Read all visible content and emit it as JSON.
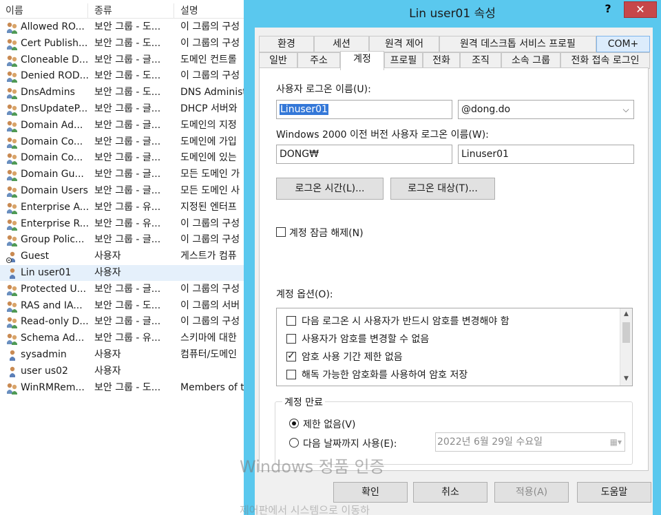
{
  "list": {
    "columns": [
      "이름",
      "종류",
      "설명"
    ],
    "rows": [
      {
        "name": "Allowed RO...",
        "type": "보안 그룹 - 도...",
        "desc": "이 그룹의 구성",
        "icon": "group-icon"
      },
      {
        "name": "Cert Publish...",
        "type": "보안 그룹 - 도...",
        "desc": "이 그룹의 구성",
        "icon": "group-icon"
      },
      {
        "name": "Cloneable D...",
        "type": "보안 그룹 - 글...",
        "desc": "도메인 컨트롤",
        "icon": "group-icon"
      },
      {
        "name": "Denied ROD...",
        "type": "보안 그룹 - 도...",
        "desc": "이 그룹의 구성",
        "icon": "group-icon"
      },
      {
        "name": "DnsAdmins",
        "type": "보안 그룹 - 도...",
        "desc": "DNS Administ",
        "icon": "group-icon"
      },
      {
        "name": "DnsUpdateP...",
        "type": "보안 그룹 - 글...",
        "desc": "DHCP 서버와",
        "icon": "group-icon"
      },
      {
        "name": "Domain Ad...",
        "type": "보안 그룹 - 글...",
        "desc": "도메인의 지정",
        "icon": "group-icon"
      },
      {
        "name": "Domain Co...",
        "type": "보안 그룹 - 글...",
        "desc": "도메인에 가입",
        "icon": "group-icon"
      },
      {
        "name": "Domain Co...",
        "type": "보안 그룹 - 글...",
        "desc": "도메인에 있는",
        "icon": "group-icon"
      },
      {
        "name": "Domain Gu...",
        "type": "보안 그룹 - 글...",
        "desc": "모든 도메인 가",
        "icon": "group-icon"
      },
      {
        "name": "Domain Users",
        "type": "보안 그룹 - 글...",
        "desc": "모든 도메인 사",
        "icon": "group-icon"
      },
      {
        "name": "Enterprise A...",
        "type": "보안 그룹 - 유...",
        "desc": "지정된 엔터프",
        "icon": "group-icon"
      },
      {
        "name": "Enterprise R...",
        "type": "보안 그룹 - 유...",
        "desc": "이 그룹의 구성",
        "icon": "group-icon"
      },
      {
        "name": "Group Polic...",
        "type": "보안 그룹 - 글...",
        "desc": "이 그룹의 구성",
        "icon": "group-icon"
      },
      {
        "name": "Guest",
        "type": "사용자",
        "desc": "게스트가 컴퓨",
        "icon": "disabled-user-icon"
      },
      {
        "name": "Lin user01",
        "type": "사용자",
        "desc": "",
        "icon": "user-icon"
      },
      {
        "name": "Protected U...",
        "type": "보안 그룹 - 글...",
        "desc": "이 그룹의 구성",
        "icon": "group-icon"
      },
      {
        "name": "RAS and IA...",
        "type": "보안 그룹 - 도...",
        "desc": "이 그룹의 서버",
        "icon": "group-icon"
      },
      {
        "name": "Read-only D...",
        "type": "보안 그룹 - 글...",
        "desc": "이 그룹의 구성",
        "icon": "group-icon"
      },
      {
        "name": "Schema Ad...",
        "type": "보안 그룹 - 유...",
        "desc": "스키마에 대한",
        "icon": "group-icon"
      },
      {
        "name": "sysadmin",
        "type": "사용자",
        "desc": "컴퓨터/도메인",
        "icon": "user-icon"
      },
      {
        "name": "user us02",
        "type": "사용자",
        "desc": "",
        "icon": "user-icon"
      },
      {
        "name": "WinRMRem...",
        "type": "보안 그룹 - 도...",
        "desc": "Members of t",
        "icon": "group-icon"
      }
    ]
  },
  "dialog": {
    "title": "Lin user01 속성",
    "help_label": "?",
    "close_label": "✕",
    "tabs_row1": [
      "환경",
      "세션",
      "원격 제어",
      "원격 데스크톱 서비스 프로필",
      "COM+"
    ],
    "tabs_row2": [
      "일반",
      "주소",
      "계정",
      "프로필",
      "전화",
      "조직",
      "소속 그룹",
      "전화 접속 로그인"
    ],
    "account": {
      "logon_name_label": "사용자 로그온 이름(U):",
      "logon_name": "Linuser01",
      "domain": "@dong.do",
      "pre2000_label": "Windows 2000 이전 버전 사용자 로그온 이름(W):",
      "pre2000_domain": "DONG₩",
      "pre2000_name": "Linuser01",
      "logon_hours_button": "로그온 시간(L)...",
      "logon_to_button": "로그온 대상(T)...",
      "unlock_label": "계정 잠금 해제(N)",
      "options_label": "계정 옵션(O):",
      "options": [
        {
          "label": "다음 로그온 시 사용자가 반드시 암호를 변경해야 함",
          "checked": false
        },
        {
          "label": "사용자가 암호를 변경할 수 없음",
          "checked": false
        },
        {
          "label": "암호 사용 기간 제한 없음",
          "checked": true
        },
        {
          "label": "해독 가능한 암호화를 사용하여 암호 저장",
          "checked": false
        }
      ],
      "expires_label": "계정 만료",
      "never_label": "제한 없음(V)",
      "end_of_label": "다음 날짜까지 사용(E):",
      "date_value": "2022년   6월 29일 수요일"
    },
    "buttons": {
      "ok": "확인",
      "cancel": "취소",
      "apply": "적용(A)",
      "help": "도움말"
    }
  },
  "watermark": {
    "main": "Windows 정품 인증",
    "sub": "제어판에서 시스템으로 이동하"
  }
}
